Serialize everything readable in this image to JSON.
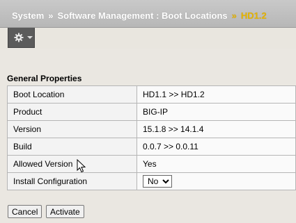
{
  "breadcrumb": {
    "root": "System",
    "separator": "»",
    "section": "Software Management : Boot Locations",
    "current": "HD1.2"
  },
  "toolbar": {
    "menu_icon": "gear-icon"
  },
  "general_properties": {
    "title": "General Properties",
    "rows": [
      {
        "label": "Boot Location",
        "value": "HD1.1 >> HD1.2"
      },
      {
        "label": "Product",
        "value": "BIG-IP"
      },
      {
        "label": "Version",
        "value": "15.1.8 >> 14.1.4"
      },
      {
        "label": "Build",
        "value": "0.0.7 >> 0.0.11"
      },
      {
        "label": "Allowed Version",
        "value": "Yes"
      },
      {
        "label": "Install Configuration",
        "value": "No"
      }
    ]
  },
  "buttons": {
    "cancel": "Cancel",
    "activate": "Activate"
  },
  "colors": {
    "breadcrumb_accent": "#e6b400",
    "header_bg": "#bdbdbd",
    "page_bg": "#eae7e1"
  }
}
